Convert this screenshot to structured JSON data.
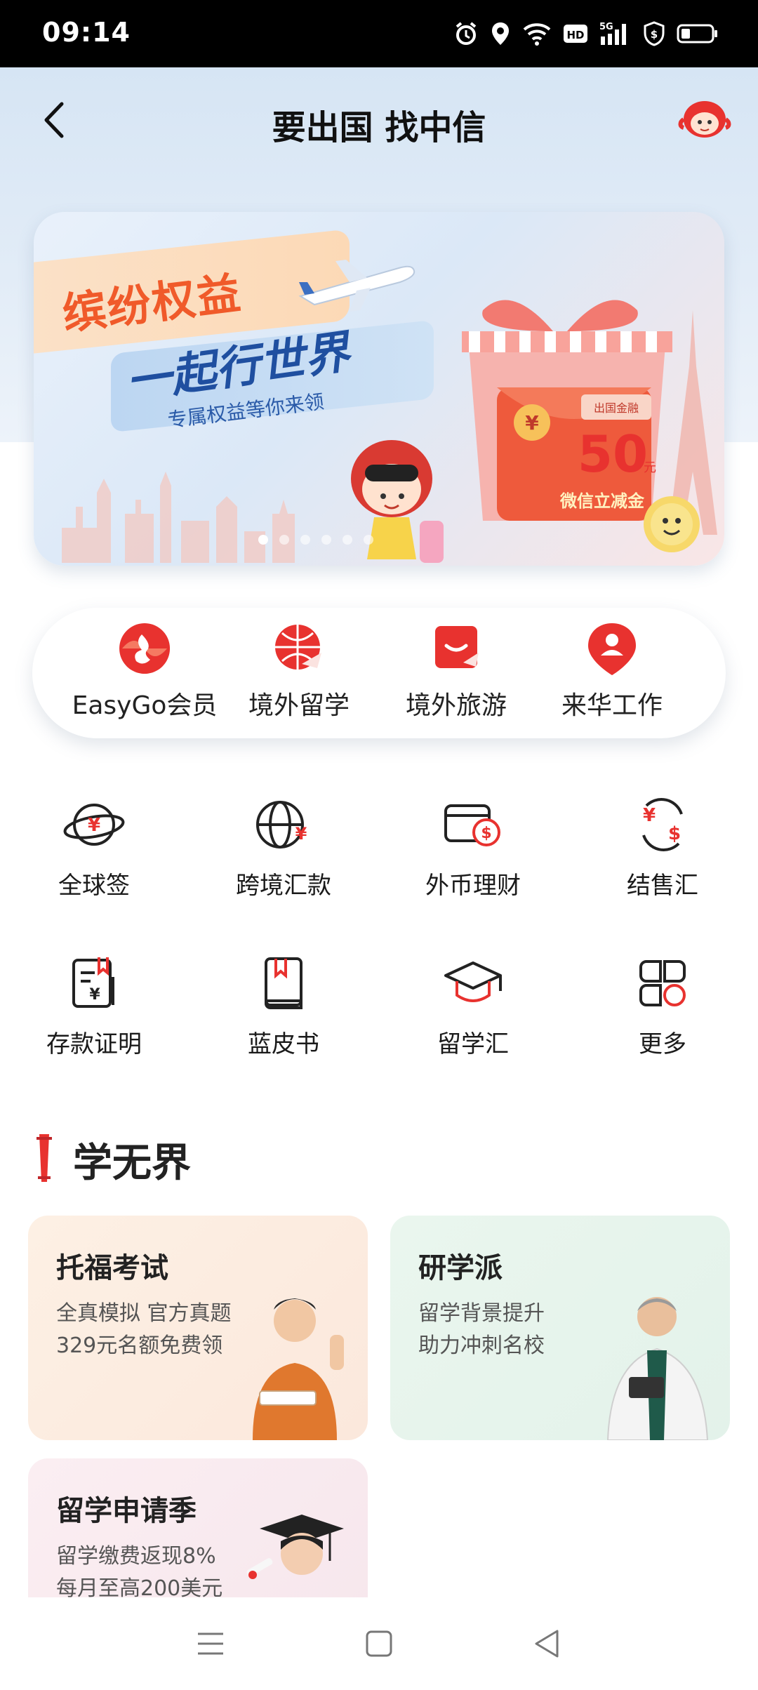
{
  "status_bar": {
    "time": "09:14",
    "icons": [
      "alarm-icon",
      "location-icon",
      "wifi-icon",
      "hd-icon",
      "signal-5g-icon",
      "shield-icon",
      "battery-icon"
    ]
  },
  "header": {
    "title": "要出国 找中信",
    "back_icon": "back-arrow-icon",
    "mascot_icon": "mascot-avatar-icon"
  },
  "banner": {
    "line1": "缤纷权益",
    "line2": "一起行世界",
    "line3": "专属权益等你来领",
    "coupon_tag": "出国金融",
    "coupon_amount": "50",
    "coupon_unit": "元",
    "coupon_caption": "微信立减金",
    "slides_total": 6,
    "slide_active": 1
  },
  "quick_menu": [
    {
      "label": "EasyGo会员",
      "icon": "easygo-member-icon"
    },
    {
      "label": "境外留学",
      "icon": "overseas-study-icon"
    },
    {
      "label": "境外旅游",
      "icon": "overseas-travel-icon"
    },
    {
      "label": "来华工作",
      "icon": "work-in-china-icon"
    }
  ],
  "grid_menu": [
    {
      "label": "全球签",
      "icon": "global-card-icon"
    },
    {
      "label": "跨境汇款",
      "icon": "cross-border-remittance-icon"
    },
    {
      "label": "外币理财",
      "icon": "foreign-currency-wealth-icon"
    },
    {
      "label": "结售汇",
      "icon": "exchange-settlement-icon"
    },
    {
      "label": "存款证明",
      "icon": "deposit-certificate-icon"
    },
    {
      "label": "蓝皮书",
      "icon": "blue-book-icon"
    },
    {
      "label": "留学汇",
      "icon": "study-abroad-remit-icon"
    },
    {
      "label": "更多",
      "icon": "more-icon"
    }
  ],
  "section": {
    "title": "学无界"
  },
  "cards": {
    "toefl": {
      "title": "托福考试",
      "line1": "全真模拟 官方真题",
      "line2": "329元名额免费领"
    },
    "study": {
      "title": "研学派",
      "line1": "留学背景提升",
      "line2": "助力冲刺名校"
    },
    "apply": {
      "title": "留学申请季",
      "line1": "留学缴费返现8%",
      "line2": "每月至高200美元"
    }
  },
  "system_nav": [
    "menu-icon",
    "home-square-icon",
    "back-triangle-icon"
  ],
  "colors": {
    "brand_red": "#e8322f",
    "nav_bg": "#dbe7f5",
    "text_dark": "#1a1a1a"
  }
}
